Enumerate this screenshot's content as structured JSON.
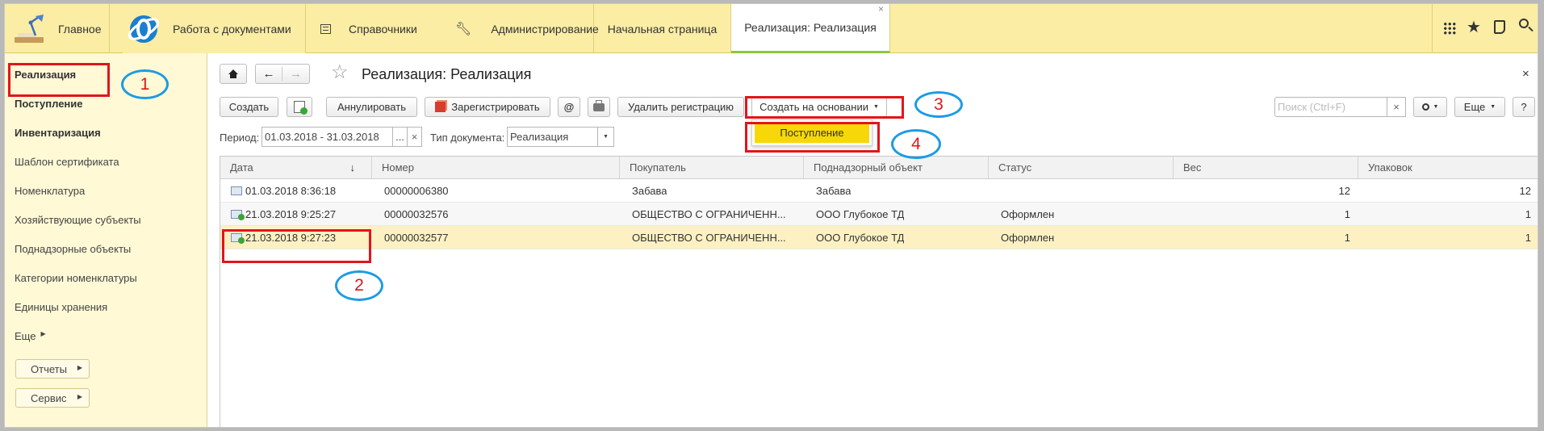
{
  "topnav": {
    "items": [
      {
        "label": "Главное"
      },
      {
        "label": "Работа с документами"
      },
      {
        "label": "Справочники"
      },
      {
        "label": "Администрирование"
      },
      {
        "label": "Начальная страница"
      },
      {
        "label": "Реализация: Реализация"
      }
    ],
    "tab_close": "×"
  },
  "sidebar": {
    "items": [
      {
        "label": "Реализация"
      },
      {
        "label": "Поступление"
      },
      {
        "label": "Инвентаризация"
      },
      {
        "label": "Шаблон сертификата"
      },
      {
        "label": "Номенклатура"
      },
      {
        "label": "Хозяйствующие субъекты"
      },
      {
        "label": "Поднадзорные объекты"
      },
      {
        "label": "Категории номенклатуры"
      },
      {
        "label": "Единицы хранения"
      },
      {
        "label": "Еще"
      }
    ],
    "reports_label": "Отчеты",
    "service_label": "Сервис"
  },
  "form": {
    "title": "Реализация: Реализация",
    "close": "×",
    "toolbar": {
      "create": "Создать",
      "annul": "Аннулировать",
      "register": "Зарегистрировать",
      "email": "@",
      "delete_reg": "Удалить регистрацию",
      "create_based": "Создать на основании",
      "search_placeholder": "Поиск (Ctrl+F)",
      "search_clear": "×",
      "more": "Еще",
      "help": "?"
    },
    "dropdown_item": "Поступление",
    "filters": {
      "period_label": "Период:",
      "period_value": "01.03.2018 - 31.03.2018",
      "period_select": "...",
      "period_clear": "×",
      "doctype_label": "Тип документа:",
      "doctype_value": "Реализация"
    }
  },
  "table": {
    "columns": [
      "Дата",
      "Номер",
      "Покупатель",
      "Поднадзорный объект",
      "Статус",
      "Вес",
      "Упаковок"
    ],
    "sort_indicator": "↓",
    "rows": [
      {
        "date": "01.03.2018 8:36:18",
        "number": "00000006380",
        "buyer": "Забава",
        "object": "Забава",
        "status": "",
        "weight": "12",
        "packs": "12"
      },
      {
        "date": "21.03.2018 9:25:27",
        "number": "00000032576",
        "buyer": "ОБЩЕСТВО С ОГРАНИЧЕНН...",
        "object": "ООО Глубокое ТД",
        "status": "Оформлен",
        "weight": "1",
        "packs": "1"
      },
      {
        "date": "21.03.2018 9:27:23",
        "number": "00000032577",
        "buyer": "ОБЩЕСТВО С ОГРАНИЧЕНН...",
        "object": "ООО Глубокое ТД",
        "status": "Оформлен",
        "weight": "1",
        "packs": "1"
      }
    ]
  },
  "annotations": [
    "1",
    "2",
    "3",
    "4"
  ],
  "colors": {
    "accent": "#fbeda4",
    "highlight": "#f7d708",
    "marker_red": "#e1151b",
    "marker_blue": "#1e9be3"
  }
}
